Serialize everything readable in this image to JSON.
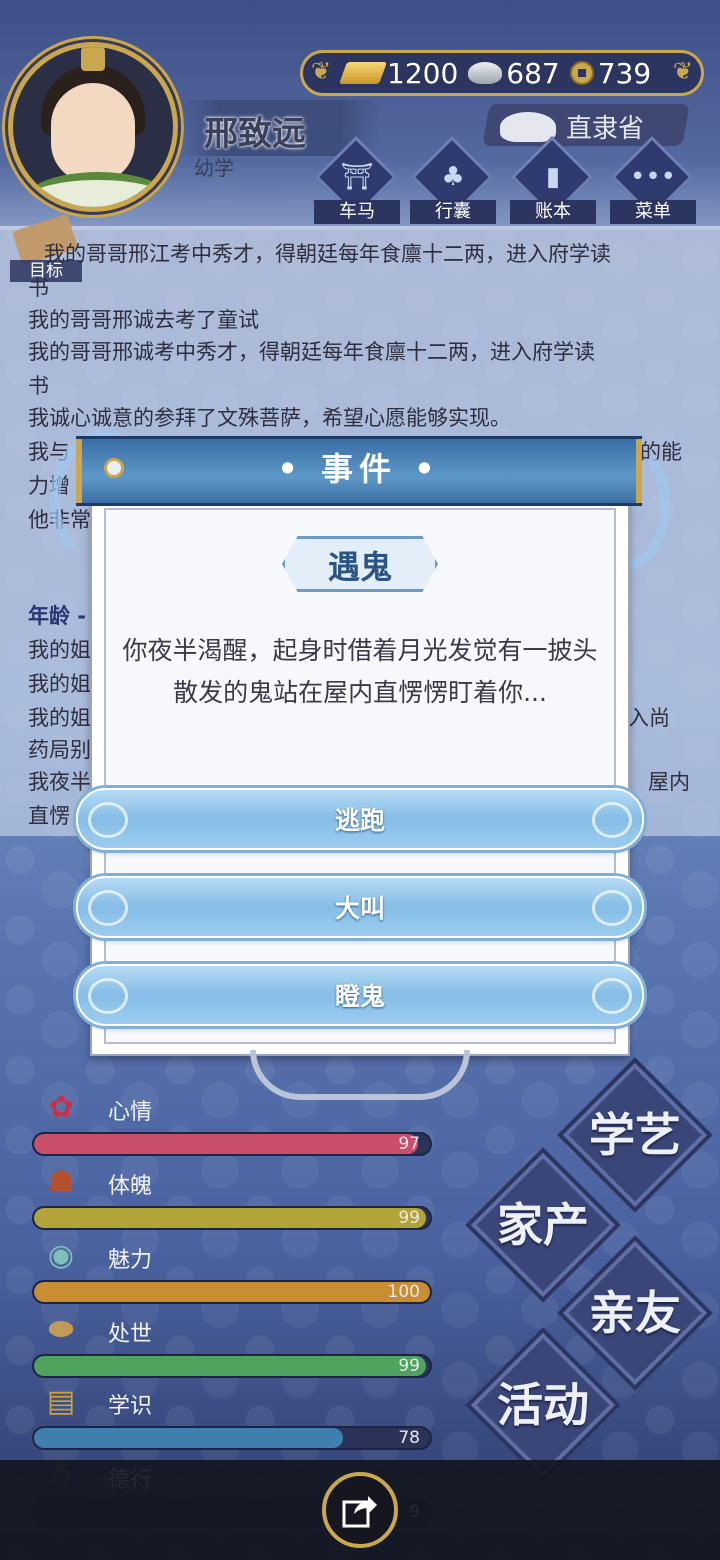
{
  "player": {
    "name": "邢致远",
    "stage": "幼学",
    "location": "直隶省"
  },
  "currency": {
    "gold": "1200",
    "silver": "687",
    "coins": "739"
  },
  "top_menu": [
    {
      "label": "车马",
      "icon": "carriage-icon"
    },
    {
      "label": "行囊",
      "icon": "bag-icon"
    },
    {
      "label": "账本",
      "icon": "ledger-icon"
    },
    {
      "label": "菜单",
      "icon": "more-icon"
    }
  ],
  "goal_label": "目标",
  "log": {
    "lines": [
      "我的哥哥邢江考中秀才，得朝廷每年食廪十二两，进入府学读",
      "书",
      "我的哥哥邢诚去考了童试",
      "我的哥哥邢诚考中秀才，得朝廷每年食廪十二两，进入府学读",
      "书",
      "我诚心诚意的参拜了文殊菩萨，希望心愿能够实现。",
      "我与",
      "力增",
      "他非常"
    ],
    "age_header": "年龄 -",
    "lines2": [
      "我的姐",
      "我的姐",
      "我的姐",
      "药局别",
      "我夜半",
      "直愣"
    ],
    "right_fragments": [
      "的能",
      "入尚",
      "屋内"
    ]
  },
  "event_dialog": {
    "header": "• 事件 •",
    "event_name": "遇鬼",
    "description": "你夜半渴醒，起身时借着月光发觉有一披头散发的鬼站在屋内直愣愣盯着你...",
    "choices": [
      "逃跑",
      "大叫",
      "瞪鬼"
    ]
  },
  "stats": [
    {
      "label": "心情",
      "value": "97",
      "fraction": 0.97,
      "color": "#c9506a",
      "icon": "flower-icon"
    },
    {
      "label": "体魄",
      "value": "99",
      "fraction": 0.99,
      "color": "#b3a43a",
      "icon": "drum-icon"
    },
    {
      "label": "魅力",
      "value": "100",
      "fraction": 1.0,
      "color": "#c98d33",
      "icon": "mirror-icon"
    },
    {
      "label": "处世",
      "value": "99",
      "fraction": 0.99,
      "color": "#4fa35c",
      "icon": "shoes-icon"
    },
    {
      "label": "学识",
      "value": "78",
      "fraction": 0.78,
      "color": "#3f7fae",
      "icon": "books-icon"
    },
    {
      "label": "德行",
      "value": "9",
      "fraction": 0.0,
      "color": "#7a3a6e",
      "icon": "bell-icon"
    }
  ],
  "side_actions": [
    "学艺",
    "家产",
    "亲友",
    "活动"
  ],
  "colors": {
    "accent_gold": "#c9a74e",
    "dialog_blue": "#3a6ea7",
    "panel_navy": "#2c3560"
  }
}
